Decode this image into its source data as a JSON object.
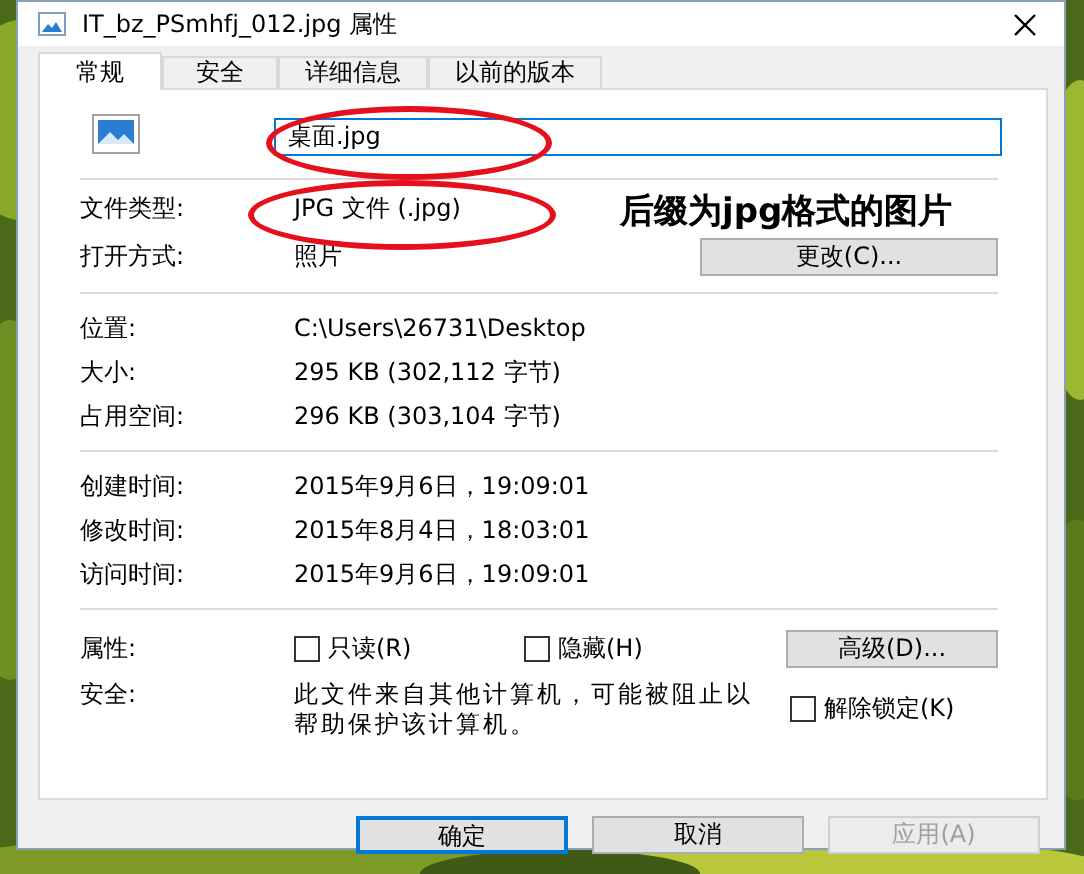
{
  "window": {
    "title": "IT_bz_PSmhfj_012.jpg 属性"
  },
  "tabs": [
    {
      "label": "常规",
      "selected": true
    },
    {
      "label": "安全",
      "selected": false
    },
    {
      "label": "详细信息",
      "selected": false
    },
    {
      "label": "以前的版本",
      "selected": false
    }
  ],
  "file_name": {
    "value": "桌面.jpg"
  },
  "sections": [
    {
      "rows": [
        {
          "label": "文件类型:",
          "value": "JPG 文件 (.jpg)"
        },
        {
          "label": "打开方式:",
          "value": "照片",
          "button": "更改(C)..."
        }
      ]
    },
    {
      "rows": [
        {
          "label": "位置:",
          "value": "C:\\Users\\26731\\Desktop"
        },
        {
          "label": "大小:",
          "value": "295 KB (302,112 字节)"
        },
        {
          "label": "占用空间:",
          "value": "296 KB (303,104 字节)"
        }
      ]
    },
    {
      "rows": [
        {
          "label": "创建时间:",
          "value": "2015年9月6日，19:09:01"
        },
        {
          "label": "修改时间:",
          "value": "2015年8月4日，18:03:01"
        },
        {
          "label": "访问时间:",
          "value": "2015年9月6日，19:09:01"
        }
      ]
    }
  ],
  "attributes": {
    "label": "属性:",
    "options": [
      {
        "label": "只读(R)",
        "checked": false
      },
      {
        "label": "隐藏(H)",
        "checked": false
      }
    ],
    "button": "高级(D)..."
  },
  "security": {
    "label": "安全:",
    "text": "此文件来自其他计算机，可能被阻止以帮助保护该计算机。",
    "unblock": {
      "label": "解除锁定(K)",
      "checked": false
    }
  },
  "buttons": [
    {
      "label": "确定",
      "focused": true,
      "disabled": false
    },
    {
      "label": "取消",
      "focused": false,
      "disabled": false
    },
    {
      "label": "应用(A)",
      "focused": false,
      "disabled": true
    }
  ],
  "annotation": {
    "text": "后缀为jpg格式的图片"
  }
}
